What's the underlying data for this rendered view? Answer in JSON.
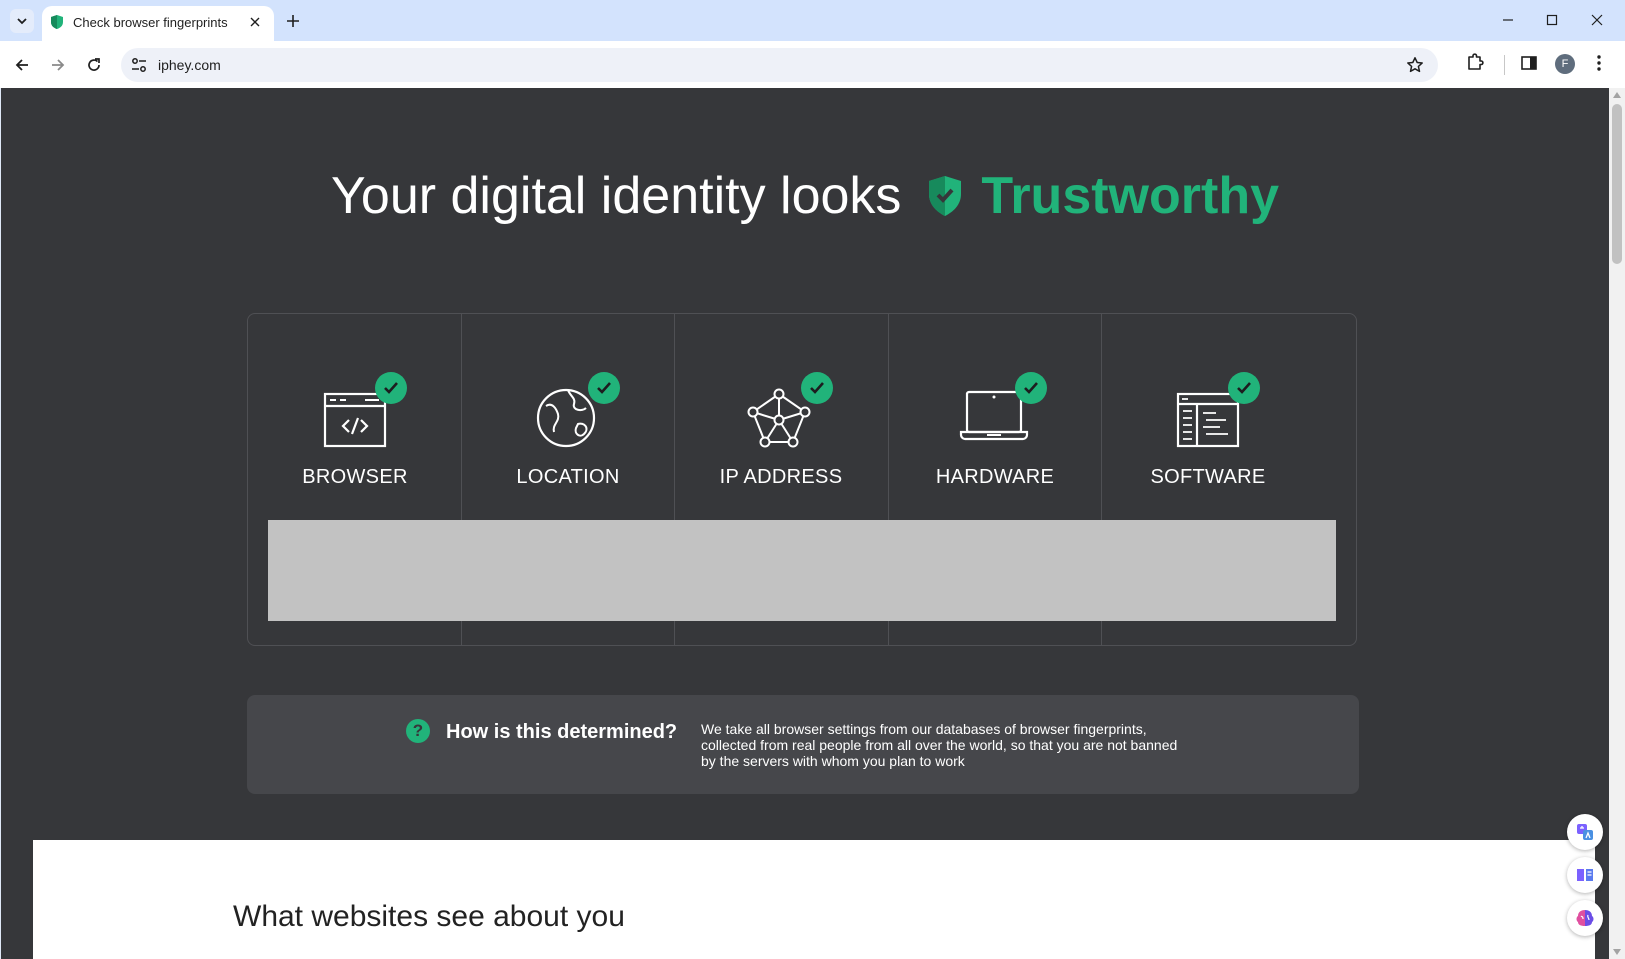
{
  "browser": {
    "tab_title": "Check browser fingerprints",
    "url": "iphey.com",
    "avatar_letter": "F"
  },
  "page": {
    "headline_prefix": "Your digital identity looks",
    "verdict": "Trustworthy",
    "accent_color": "#21b37a",
    "categories": [
      {
        "label": "BROWSER",
        "icon": "browser-code-icon",
        "status": "ok"
      },
      {
        "label": "LOCATION",
        "icon": "globe-icon",
        "status": "ok"
      },
      {
        "label": "IP ADDRESS",
        "icon": "network-icon",
        "status": "ok"
      },
      {
        "label": "HARDWARE",
        "icon": "laptop-icon",
        "status": "ok"
      },
      {
        "label": "SOFTWARE",
        "icon": "software-window-icon",
        "status": "ok"
      }
    ],
    "info": {
      "title": "How is this determined?",
      "description": "We take all browser settings from our databases of browser fingerprints, collected from real people from all over the world, so that you are not banned by the servers with whom you plan to work"
    },
    "section_heading": "What websites see about you"
  }
}
